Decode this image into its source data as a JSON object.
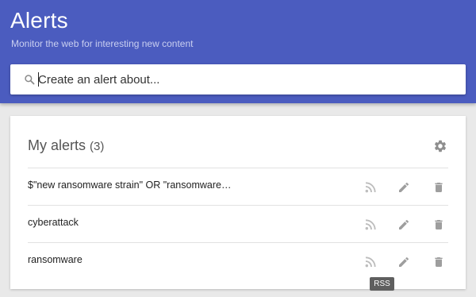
{
  "header": {
    "title": "Alerts",
    "subtitle": "Monitor the web for interesting new content",
    "search": {
      "placeholder": "Create an alert about..."
    }
  },
  "alerts_card": {
    "title": "My alerts",
    "count": "(3)",
    "items": [
      {
        "label": "$\"new ransomware strain\" OR \"ransomware…"
      },
      {
        "label": "cyberattack"
      },
      {
        "label": "ransomware"
      }
    ]
  },
  "tooltip": {
    "text": "RSS"
  },
  "icons": {
    "search": "search-icon",
    "settings": "gear-icon",
    "rss": "rss-icon",
    "edit": "pencil-icon",
    "delete": "trash-icon"
  },
  "colors": {
    "header_bg": "#4b5cbf",
    "page_bg": "#e9e9e9",
    "icon_gray": "#bdbdbd"
  }
}
